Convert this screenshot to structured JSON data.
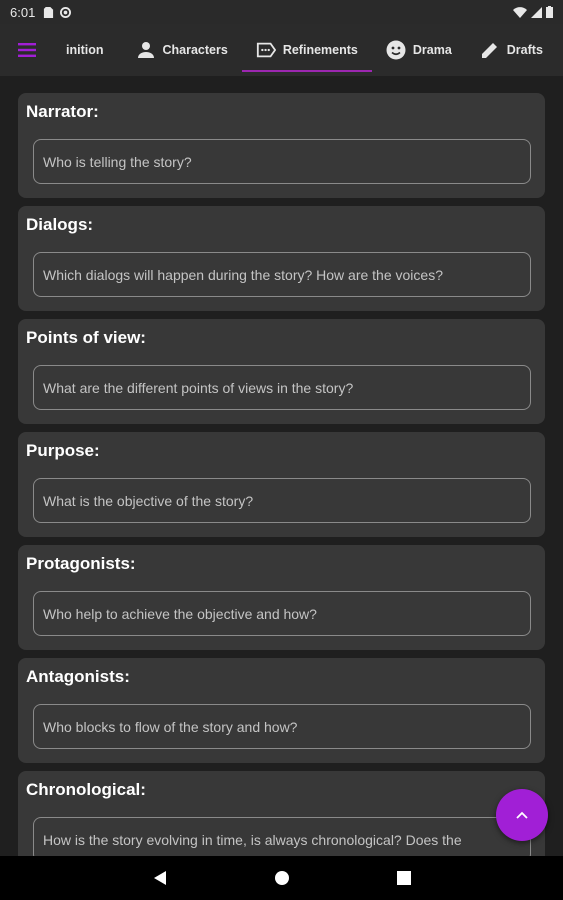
{
  "status_bar": {
    "time": "6:01"
  },
  "tabs": [
    {
      "label": "inition",
      "icon": "none"
    },
    {
      "label": "Characters",
      "icon": "person-icon"
    },
    {
      "label": "Refinements",
      "icon": "label-dots-icon",
      "active": true
    },
    {
      "label": "Drama",
      "icon": "face-icon"
    },
    {
      "label": "Drafts",
      "icon": "pencil-icon"
    }
  ],
  "cards": [
    {
      "title": "Narrator:",
      "placeholder": "Who is telling the story?"
    },
    {
      "title": "Dialogs:",
      "placeholder": "Which dialogs will happen during the story? How are the voices?"
    },
    {
      "title": "Points of view:",
      "placeholder": "What are the different points of views in the story?"
    },
    {
      "title": "Purpose:",
      "placeholder": "What is the objective of the story?"
    },
    {
      "title": "Protagonists:",
      "placeholder": "Who help to achieve the objective and how?"
    },
    {
      "title": "Antagonists:",
      "placeholder": "Who blocks to flow of the story and how?"
    },
    {
      "title": "Chronological:",
      "placeholder": "How is the story evolving in time, is always chronological? Does the"
    }
  ],
  "colors": {
    "accent": "#9c27b0",
    "fab": "#a11fd6",
    "card": "#383838",
    "background": "#1f1f1f"
  }
}
